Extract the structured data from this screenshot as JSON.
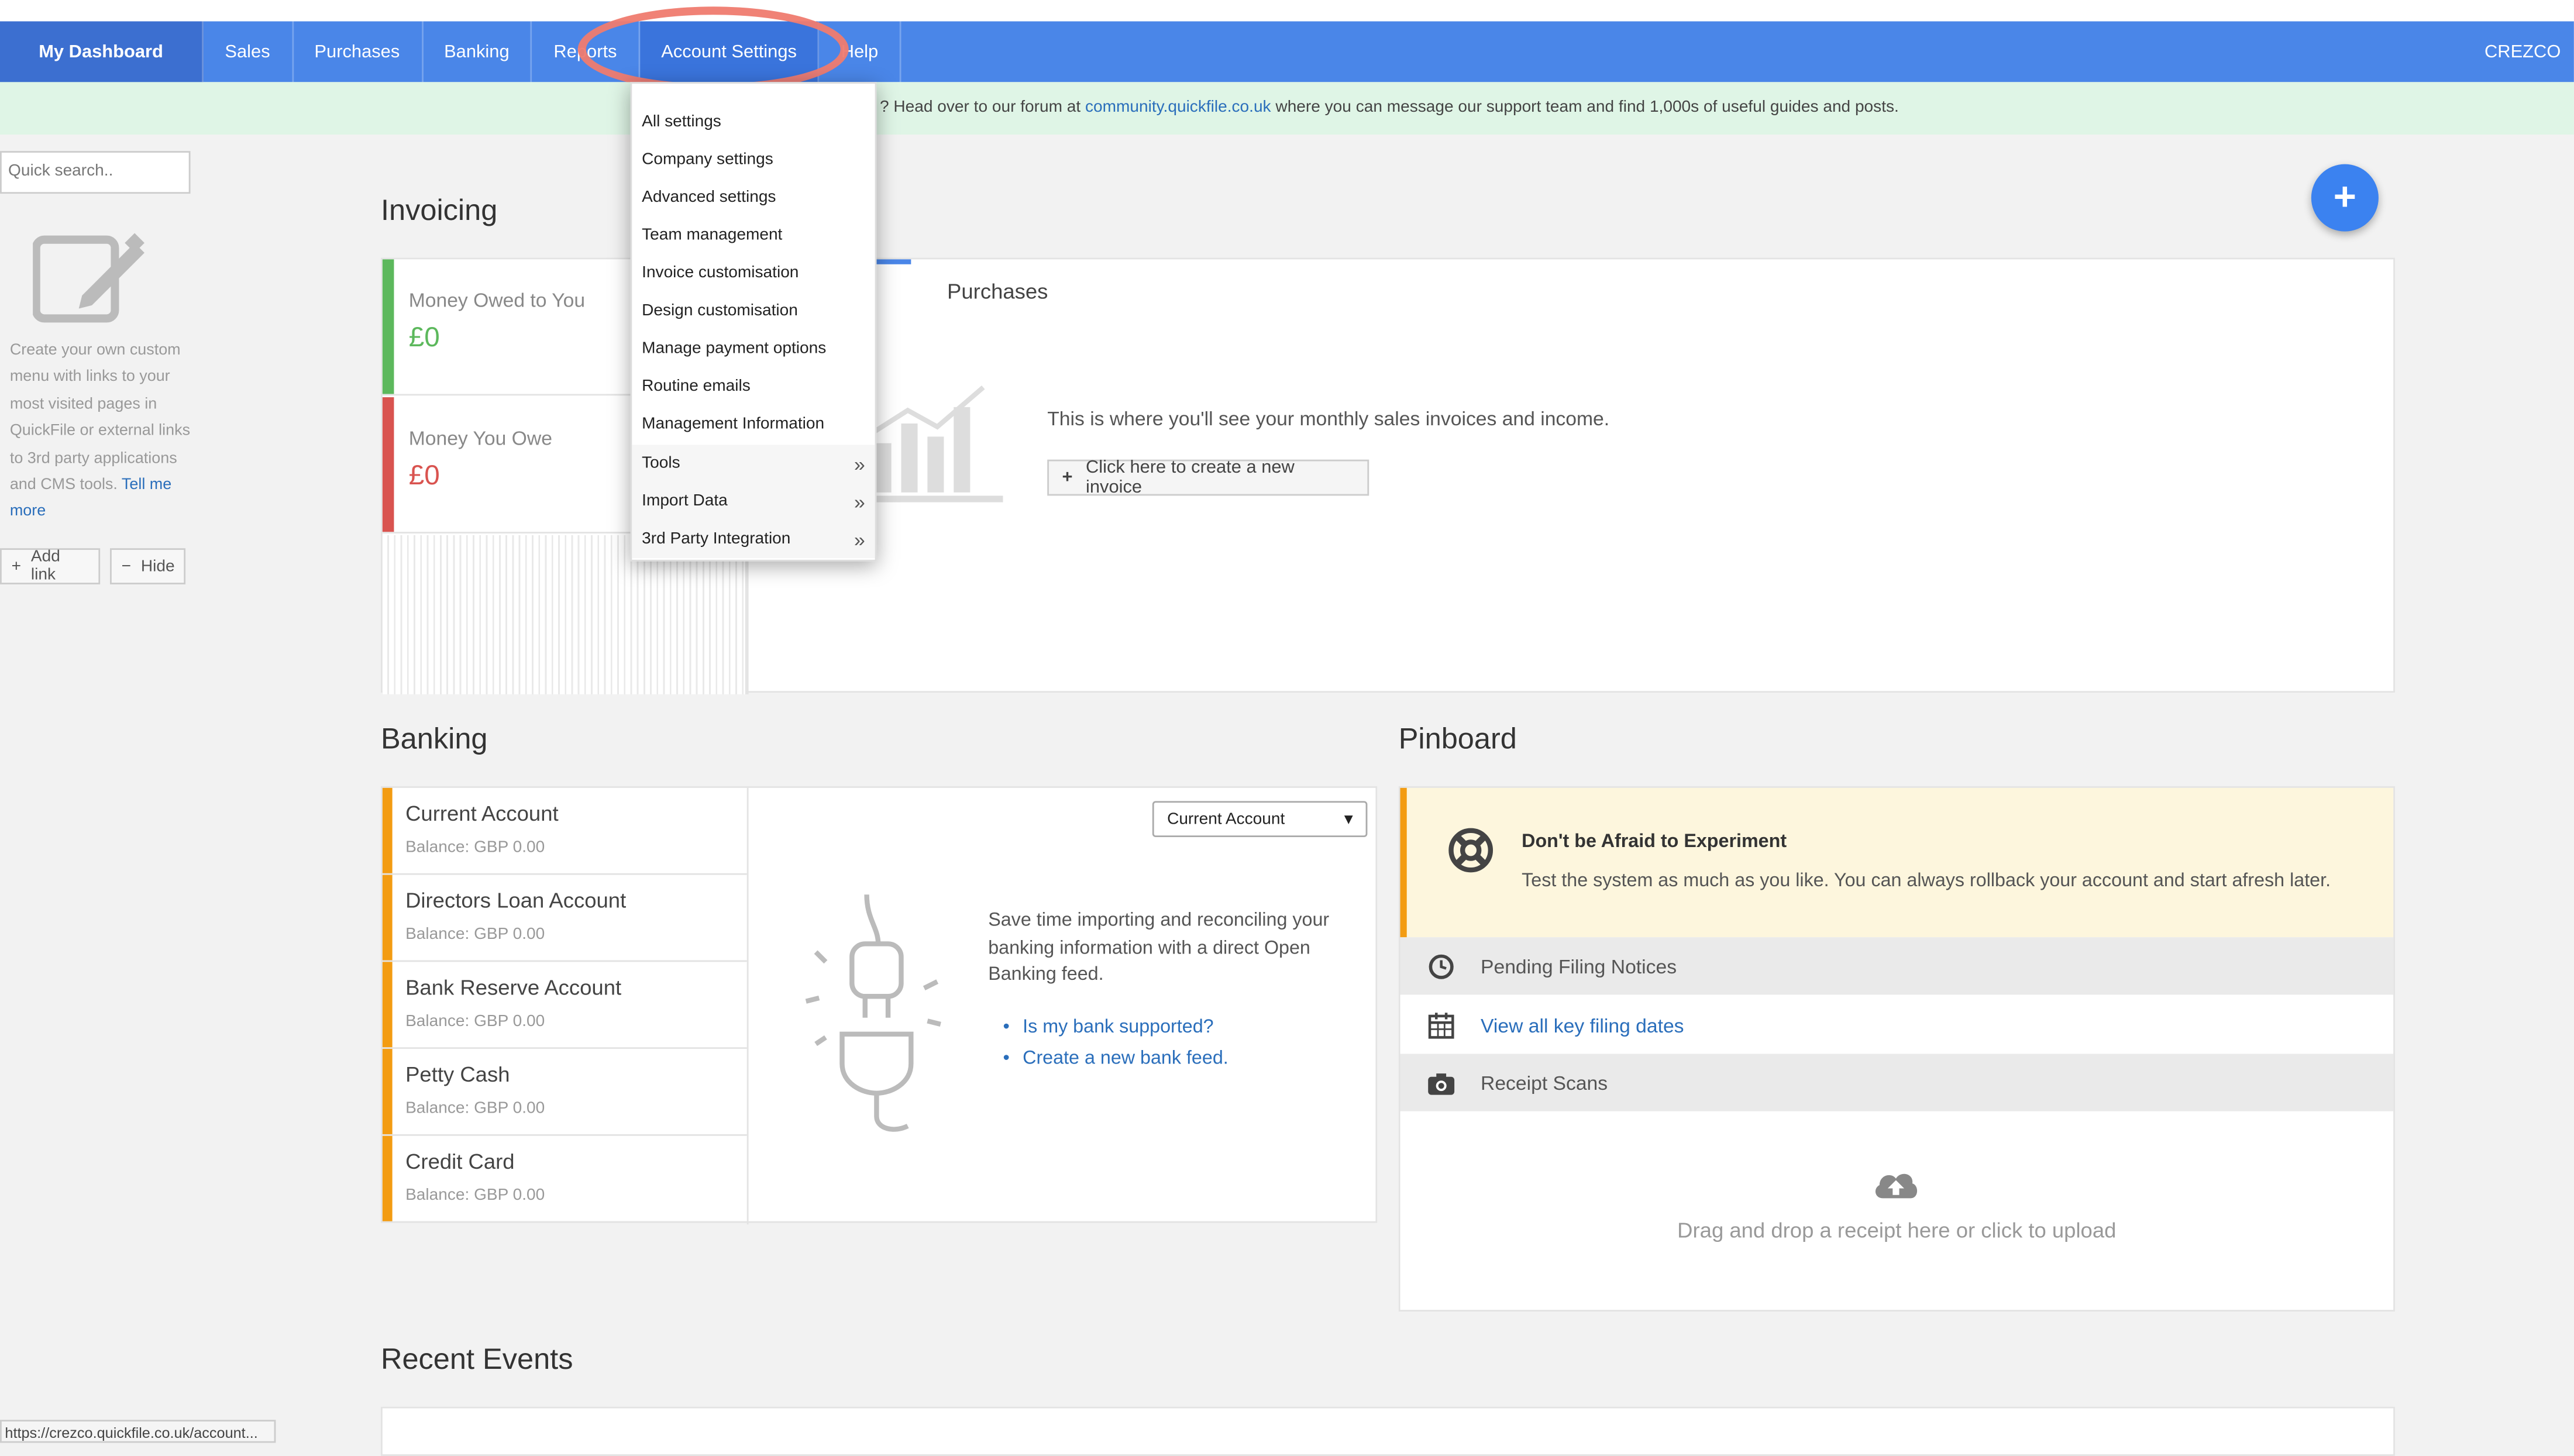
{
  "nav": {
    "home": "My Dashboard",
    "items": [
      "Sales",
      "Purchases",
      "Banking",
      "Reports",
      "Account Settings",
      "Help"
    ],
    "company": "CREZCO"
  },
  "notice": {
    "before": "? Head over to our forum at ",
    "link": "community.quickfile.co.uk",
    "after": " where you can message our support team and find 1,000s of useful guides and posts."
  },
  "sidebar": {
    "search_placeholder": "Quick search..",
    "text": "Create your own custom menu with links to your most visited pages in QuickFile or external links to 3rd party applications and CMS tools.",
    "tell_more": "Tell me more",
    "add_link": "Add link",
    "hide": "Hide"
  },
  "status_url": "https://crezco.quickfile.co.uk/account...",
  "dropdown": {
    "items": [
      {
        "label": "All settings"
      },
      {
        "label": "Company settings"
      },
      {
        "label": "Advanced settings"
      },
      {
        "label": "Team management"
      },
      {
        "label": "Invoice customisation"
      },
      {
        "label": "Design customisation"
      },
      {
        "label": "Manage payment options"
      },
      {
        "label": "Routine emails"
      },
      {
        "label": "Management Information"
      },
      {
        "label": "Tools"
      },
      {
        "label": "Import Data"
      },
      {
        "label": "3rd Party Integration"
      }
    ]
  },
  "invoicing": {
    "title": "Invoicing",
    "owed_label": "Money Owed to You",
    "owed_value": "£0",
    "owe_label": "Money You Owe",
    "owe_value": "£0",
    "purchases_tab": "Purchases",
    "message": "This is where you'll see your monthly sales invoices and income.",
    "create_button": "Click here to create a new invoice",
    "colors": {
      "owed": "#5cb85c",
      "owe": "#d9534f"
    }
  },
  "banking": {
    "title": "Banking",
    "accounts": [
      {
        "name": "Current Account",
        "balance": "Balance: GBP 0.00"
      },
      {
        "name": "Directors Loan Account",
        "balance": "Balance: GBP 0.00"
      },
      {
        "name": "Bank Reserve Account",
        "balance": "Balance: GBP 0.00"
      },
      {
        "name": "Petty Cash",
        "balance": "Balance: GBP 0.00"
      },
      {
        "name": "Credit Card",
        "balance": "Balance: GBP 0.00"
      }
    ],
    "selected_account": "Current Account",
    "message": "Save time importing and reconciling your banking information with a direct Open Banking feed.",
    "links": [
      "Is my bank supported?",
      "Create a new bank feed."
    ]
  },
  "pinboard": {
    "title": "Pinboard",
    "alert_title": "Don't be Afraid to Experiment",
    "alert_body": "Test the system as much as you like. You can always rollback your account and start afresh later.",
    "pending": "Pending Filing Notices",
    "filing_dates": "View all key filing dates",
    "receipt_scans": "Receipt Scans",
    "upload_text": "Drag and drop a receipt here or click to upload"
  },
  "recent": {
    "title": "Recent Events"
  },
  "colors": {
    "nav": "#4a86e8",
    "accent_orange": "#f39c12",
    "highlight_ring": "#ef7b6f"
  }
}
